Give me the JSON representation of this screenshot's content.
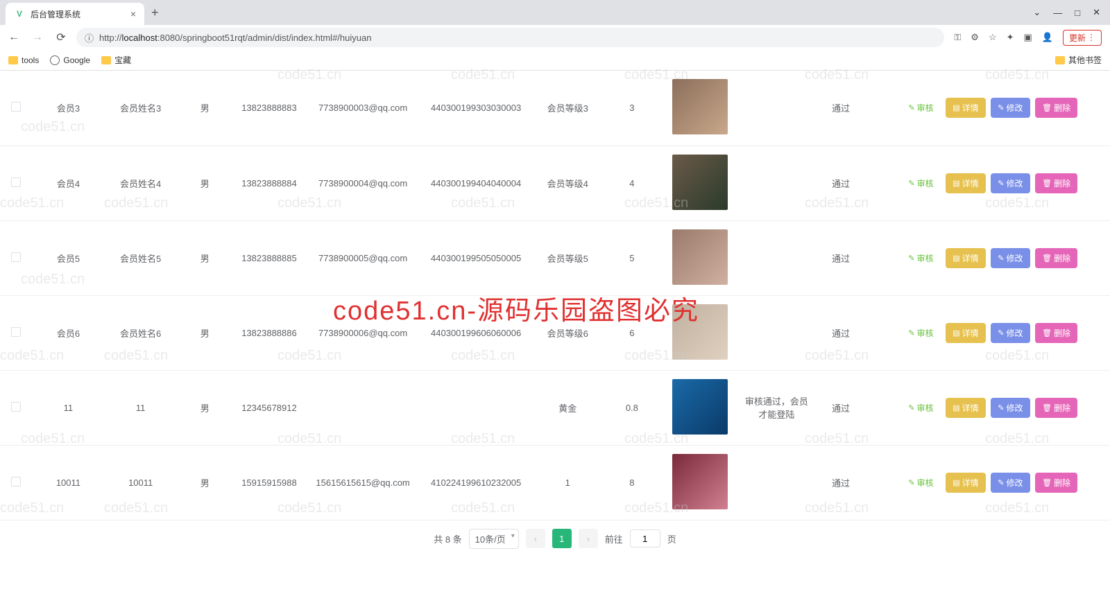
{
  "browser": {
    "tab_title": "后台管理系统",
    "new_tab": "+",
    "close": "×",
    "nav": {
      "back": "←",
      "forward": "→",
      "reload": "⟳"
    },
    "url_prefix": "http://",
    "url_host": "localhost",
    "url_rest": ":8080/springboot51rqt/admin/dist/index.html#/huiyuan",
    "update_label": "更新",
    "window": {
      "min": "—",
      "max": "□",
      "close": "✕",
      "chevron": "⌄"
    }
  },
  "bookmarks": {
    "items": [
      {
        "label": "tools",
        "type": "folder"
      },
      {
        "label": "Google",
        "type": "globe"
      },
      {
        "label": "宝藏",
        "type": "folder"
      }
    ],
    "other": "其他书签"
  },
  "table": {
    "rows": [
      {
        "c1": "会员3",
        "c2": "会员姓名3",
        "c3": "男",
        "c4": "13823888883",
        "c5": "7738900003@qq.com",
        "c6": "440300199303030003",
        "c7": "会员等级3",
        "c8": "3",
        "c9": "",
        "status": "通过",
        "avatar": "a1"
      },
      {
        "c1": "会员4",
        "c2": "会员姓名4",
        "c3": "男",
        "c4": "13823888884",
        "c5": "7738900004@qq.com",
        "c6": "440300199404040004",
        "c7": "会员等级4",
        "c8": "4",
        "c9": "",
        "status": "通过",
        "avatar": "a2"
      },
      {
        "c1": "会员5",
        "c2": "会员姓名5",
        "c3": "男",
        "c4": "13823888885",
        "c5": "7738900005@qq.com",
        "c6": "440300199505050005",
        "c7": "会员等级5",
        "c8": "5",
        "c9": "",
        "status": "通过",
        "avatar": "a3"
      },
      {
        "c1": "会员6",
        "c2": "会员姓名6",
        "c3": "男",
        "c4": "13823888886",
        "c5": "7738900006@qq.com",
        "c6": "440300199606060006",
        "c7": "会员等级6",
        "c8": "6",
        "c9": "",
        "status": "通过",
        "avatar": "a4"
      },
      {
        "c1": "11",
        "c2": "11",
        "c3": "男",
        "c4": "12345678912",
        "c5": "",
        "c6": "",
        "c7": "黄金",
        "c8": "0.8",
        "c9": "审核通过，会员才能登陆",
        "status": "通过",
        "avatar": "a5"
      },
      {
        "c1": "10011",
        "c2": "10011",
        "c3": "男",
        "c4": "15915915988",
        "c5": "15615615615@qq.com",
        "c6": "410224199610232005",
        "c7": "1",
        "c8": "8",
        "c9": "",
        "status": "通过",
        "avatar": "a6"
      }
    ]
  },
  "actions": {
    "review": "审核",
    "detail": "详情",
    "edit": "修改",
    "delete": "删除"
  },
  "pagination": {
    "total_label": "共 8 条",
    "page_size": "10条/页",
    "prev": "‹",
    "next": "›",
    "current": "1",
    "goto_prefix": "前往",
    "goto_value": "1",
    "goto_suffix": "页"
  },
  "watermark": {
    "small": "code51.cn",
    "big": "code51.cn-源码乐园盗图必究"
  }
}
